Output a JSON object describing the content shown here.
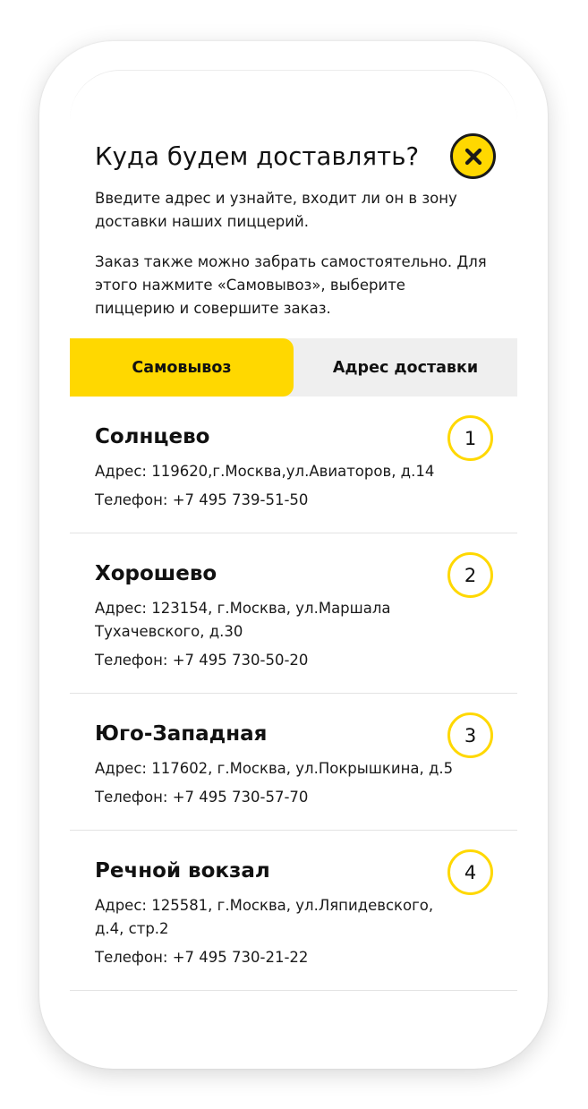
{
  "header": {
    "title": "Куда будем доставлять?",
    "close_icon": "close-icon"
  },
  "intro": {
    "paragraph1": "Введите адрес и узнайте, входит ли он в зону доставки наших пиццерий.",
    "paragraph2": "Заказ также можно забрать самостоятельно. Для этого нажмите «Самовывоз», выберите пиццерию и совершите заказ."
  },
  "tabs": [
    {
      "label": "Самовывоз",
      "active": true
    },
    {
      "label": "Адрес доставки",
      "active": false
    }
  ],
  "colors": {
    "accent": "#ffd800",
    "text": "#111111",
    "tab_bg": "#efefef",
    "divider": "#e3e3e3"
  },
  "pizzerias": [
    {
      "number": "1",
      "name": "Солнцево",
      "address": "Адрес: 119620,г.Москва,ул.Авиаторов, д.14",
      "phone": "Телефон: +7 495 739-51-50"
    },
    {
      "number": "2",
      "name": "Хорошево",
      "address": "Адрес: 123154, г.Москва, ул.Маршала Тухачевского, д.30",
      "phone": "Телефон: +7 495 730-50-20"
    },
    {
      "number": "3",
      "name": "Юго-Западная",
      "address": "Адрес: 117602, г.Москва, ул.Покрышкина, д.5",
      "phone": "Телефон: +7 495 730-57-70"
    },
    {
      "number": "4",
      "name": "Речной вокзал",
      "address": "Адрес: 125581, г.Москва, ул.Ляпидевского, д.4, стр.2",
      "phone": "Телефон: +7 495 730-21-22"
    }
  ]
}
